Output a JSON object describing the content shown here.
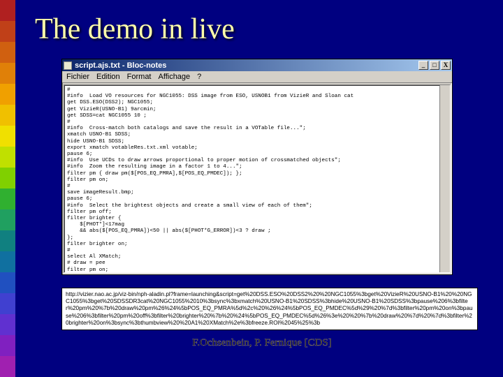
{
  "slide": {
    "title": "The demo in live",
    "footer": "F.Ochsenbein, P. Fernique [CDS]"
  },
  "rainbow_colors": [
    "#b02020",
    "#c04018",
    "#d06010",
    "#e08008",
    "#f0a000",
    "#f0c000",
    "#f0e000",
    "#c0e000",
    "#80d000",
    "#30b030",
    "#20a060",
    "#108080",
    "#1070a0",
    "#2050c0",
    "#4040d0",
    "#6030d0",
    "#8020c0",
    "#a020b0"
  ],
  "window": {
    "title": "script.ajs.txt - Bloc-notes",
    "menu": [
      "Fichier",
      "Edition",
      "Format",
      "Affichage",
      "?"
    ],
    "buttons": {
      "min": "_",
      "max": "□",
      "close": "X"
    },
    "content": "#\n#info  Load VO resources for NGC1055: DSS image from ESO, USNOB1 from VizieR and Sloan cat\nget DSS.ESO(DSS2); NGC1055;\nget VizieR(USNO-B1) 9arcmin;\nget SDSS=cat NGC1055 10 ;\n#\n#info  Cross-match both catalogs and save the result in a VOTable file...\";\nxmatch USNO-B1 SDSS;\nhide USNO-B1 SDSS;\nexport xmatch votableRes.txt.xml votable;\npause 6;\n#info  Use UCDs to draw arrows proportional to proper motion of crossmatched objects\";\n#info  Zoom the resulting image in a factor 1 to 4...\";\nfilter pm { draw pm($[POS_EQ_PMRA],$[POS_EQ_PMDEC]); };\nfilter pm on;\n#\nsave imageResult.bmp;\npause 6;\n#info  Select the brightest objects and create a small view of each of them\";\nfilter pm off;\nfilter brighter {\n    $[PHOT*]<17mag\n    && abs($[POS_EQ_PMRA])<50 || abs($[PHOT*G_ERROR])<3 ? draw ;\n};\nfilter brighter on;\n#\nselect Al XMatch;\n# draw = pee\nfilter pm on;\nthurbview"
  },
  "url_text": "http://vizier.nao.ac.jp/viz-bin/nph-aladin.pl?frame=launching&script=get%20DSS.ESO%20DSS2%20%20NGC1055%3bget%20VizieR%20USNO-B1%20%20NGC1055%3bget%20SDSSDR3cat%20NGC1055%2010%3bsync%3bxmatch%20USNO-B1%20SDSS%3bhide%20USNO-B1%20SDSS%3bpause%206%3bfilter%20pm%20%7b%20draw%20pm%26%24%5bPOS_EQ_PMRA%5d%2c%20%26%24%5bPOS_EQ_PMDEC%5d%29%20%7d%3bfilter%20pm%20on%3bpause%206%3bfilter%20pm%20off%3bfilter%20brighter%20%7b%20%24%5bPOS_EQ_PMDEC%5d%26%3e%20%20%7b%20draw%20%7d%20%7d%3bfilter%20brighter%20on%3bsync%3bthumbview%20%20A1%20XMatch%2e%3bfreeze.ROI%2045%25%3b"
}
